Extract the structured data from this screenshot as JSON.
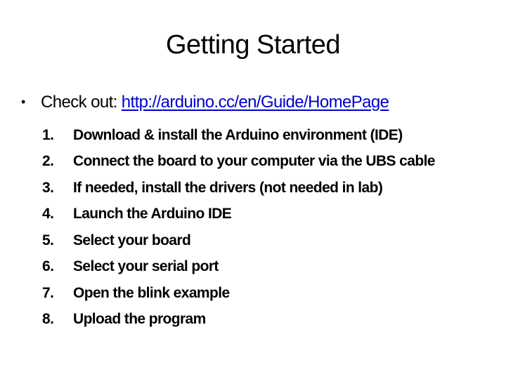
{
  "slide": {
    "title": "Getting Started",
    "bullet": {
      "symbol": "•",
      "prefix": "Check out: ",
      "link_text": "http://arduino.cc/en/Guide/HomePage",
      "link_color": "#0000cc"
    },
    "steps": [
      {
        "number": "1.",
        "text": "Download & install the Arduino environment (IDE)"
      },
      {
        "number": "2.",
        "text": "Connect the board to your computer via the UBS cable"
      },
      {
        "number": "3.",
        "text": "If needed, install the drivers (not needed in lab)"
      },
      {
        "number": "4.",
        "text": "Launch the Arduino IDE"
      },
      {
        "number": "5.",
        "text": "Select your board"
      },
      {
        "number": "6.",
        "text": "Select your serial port"
      },
      {
        "number": "7.",
        "text": "Open the blink example"
      },
      {
        "number": "8.",
        "text": "Upload the program"
      }
    ]
  }
}
